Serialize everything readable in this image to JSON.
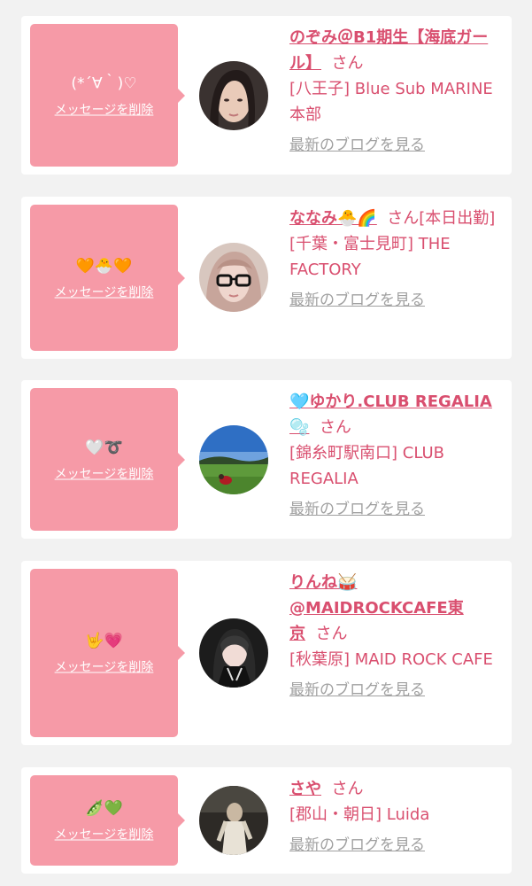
{
  "common": {
    "delete_label": "メッセージを削除",
    "blog_label": "最新のブログを見る",
    "san": "さん"
  },
  "colors": {
    "accent": "#d94f6f",
    "message_box": "#f69aa7",
    "background": "#f2f2f2"
  },
  "entries": [
    {
      "message": "(*´∀｀)♡",
      "name": "のぞみ＠B1期生【海底ガール】",
      "suffix": "",
      "shop": "[八王子] Blue Sub MARINE 本部"
    },
    {
      "message": "🧡🐣🧡",
      "name": "ななみ🐣🌈",
      "suffix": "[本日出勤]",
      "shop": "[千葉・富士見町] THE FACTORY"
    },
    {
      "message": "🤍➰",
      "name": "🩵ゆかり.CLUB REGALIA🫧",
      "suffix": "",
      "shop": "[錦糸町駅南口] CLUB REGALIA"
    },
    {
      "message": "🤟💗",
      "name": "りんね🥁@MAIDROCKCAFE東京",
      "suffix": "",
      "shop": "[秋葉原] MAID ROCK CAFE"
    },
    {
      "message": "🫛💚",
      "name": "さや",
      "suffix": "",
      "shop": "[郡山・朝日] Luida"
    }
  ]
}
